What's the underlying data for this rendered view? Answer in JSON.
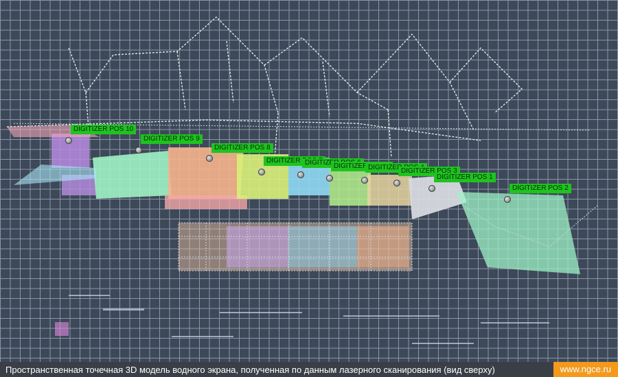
{
  "viewer": {
    "positions": [
      {
        "label": "DIGITIZER POS 10"
      },
      {
        "label": "DIGITIZER POS 9"
      },
      {
        "label": "DIGITIZER POS 8"
      },
      {
        "label": "DIGITIZER POS 7"
      },
      {
        "label": "DIGITIZER POS 6"
      },
      {
        "label": "DIGITIZER POS 5"
      },
      {
        "label": "DIGITIZER POS 4"
      },
      {
        "label": "DIGITIZER POS 3"
      },
      {
        "label": "DIGITIZER POS 1"
      },
      {
        "label": "DIGITIZER POS 2"
      }
    ],
    "colors": {
      "label_bg": "#1fc31f",
      "grid": "#8a97a8",
      "background": "#3d4858",
      "roof_lines": "#d7efe7"
    }
  },
  "footer": {
    "caption": "Пространственная точечная 3D модель водного экрана, полученная по данным лазерного сканирования (вид сверху)",
    "site": "www.ngce.ru",
    "site_color": "#f39a1d"
  }
}
